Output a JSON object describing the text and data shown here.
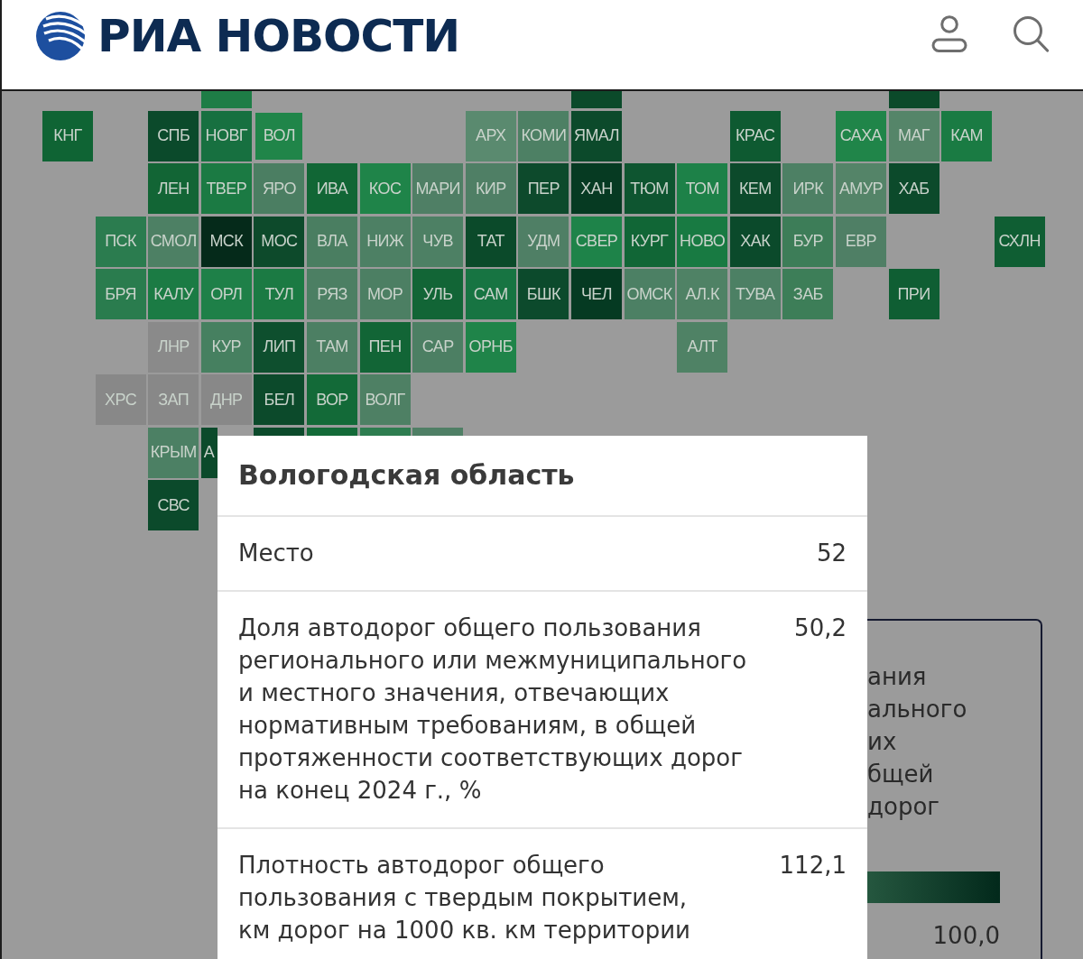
{
  "header": {
    "logo": "РИА НОВОСТИ"
  },
  "map": {
    "rows": [
      {
        "cells": [
          null,
          null,
          null,
          {
            "kind": "bottom",
            "color": "#1e7d46",
            "selected": false
          },
          null,
          null,
          null,
          null,
          null,
          null,
          {
            "kind": "bottom",
            "color": "#0b4a2a",
            "selected": false
          },
          null,
          null,
          null,
          null,
          null,
          {
            "kind": "bottom",
            "color": "#0b4a2a",
            "selected": false
          }
        ]
      },
      {
        "cells": [
          {
            "kind": "full",
            "label": "КНГ",
            "color": "#0f6434",
            "selected": false
          },
          null,
          {
            "kind": "full",
            "label": "СПБ",
            "color": "#0b4a2b",
            "selected": false
          },
          {
            "kind": "full",
            "label": "НОВГ",
            "color": "#177040",
            "selected": false
          },
          {
            "kind": "full",
            "label": "ВОЛ",
            "color": "#208549",
            "selected": true
          },
          null,
          null,
          null,
          {
            "kind": "full",
            "label": "АРХ",
            "color": "#5a8a6f",
            "selected": false
          },
          {
            "kind": "full",
            "label": "КОМИ",
            "color": "#4d8064",
            "selected": false
          },
          {
            "kind": "full",
            "label": "ЯМАЛ",
            "color": "#0c4a2b",
            "selected": false
          },
          null,
          null,
          {
            "kind": "full",
            "label": "КРАС",
            "color": "#0e5a31",
            "selected": false
          },
          null,
          {
            "kind": "full",
            "label": "САХА",
            "color": "#208549",
            "selected": false
          },
          {
            "kind": "full",
            "label": "МАГ",
            "color": "#558569",
            "selected": false
          },
          {
            "kind": "full",
            "label": "КАМ",
            "color": "#1a7b43",
            "selected": false
          }
        ]
      },
      {
        "cells": [
          null,
          null,
          {
            "kind": "full",
            "label": "ЛЕН",
            "color": "#126535",
            "selected": false
          },
          {
            "kind": "full",
            "label": "ТВЕР",
            "color": "#1b7a43",
            "selected": false
          },
          {
            "kind": "full",
            "label": "ЯРО",
            "color": "#4b7e62",
            "selected": false
          },
          {
            "kind": "full",
            "label": "ИВА",
            "color": "#116635",
            "selected": false
          },
          {
            "kind": "full",
            "label": "КОС",
            "color": "#1f8449",
            "selected": false
          },
          {
            "kind": "full",
            "label": "МАРИ",
            "color": "#4f7f65",
            "selected": false
          },
          {
            "kind": "full",
            "label": "КИР",
            "color": "#4f7f65",
            "selected": false
          },
          {
            "kind": "full",
            "label": "ПЕР",
            "color": "#0d4a2c",
            "selected": false
          },
          {
            "kind": "full",
            "label": "ХАН",
            "color": "#063a22",
            "selected": false
          },
          {
            "kind": "full",
            "label": "ТЮМ",
            "color": "#0e5530",
            "selected": false
          },
          {
            "kind": "full",
            "label": "ТОМ",
            "color": "#1d8148",
            "selected": false
          },
          {
            "kind": "full",
            "label": "КЕМ",
            "color": "#0c4a2b",
            "selected": false
          },
          {
            "kind": "full",
            "label": "ИРК",
            "color": "#4d8064",
            "selected": false
          },
          {
            "kind": "full",
            "label": "АМУР",
            "color": "#548468",
            "selected": false
          },
          {
            "kind": "full",
            "label": "ХАБ",
            "color": "#0c4a2b",
            "selected": false
          }
        ]
      },
      {
        "cells": [
          null,
          {
            "kind": "full",
            "label": "ПСК",
            "color": "#2b7c4f",
            "selected": false
          },
          {
            "kind": "full",
            "label": "СМОЛ",
            "color": "#4d8064",
            "selected": false
          },
          {
            "kind": "full",
            "label": "МСК",
            "color": "#052a1a",
            "selected": false
          },
          {
            "kind": "full",
            "label": "МОС",
            "color": "#0d4a2b",
            "selected": false
          },
          {
            "kind": "full",
            "label": "ВЛА",
            "color": "#4a7e61",
            "selected": false
          },
          {
            "kind": "full",
            "label": "НИЖ",
            "color": "#4d8064",
            "selected": false
          },
          {
            "kind": "full",
            "label": "ЧУВ",
            "color": "#4d8064",
            "selected": false
          },
          {
            "kind": "full",
            "label": "ТАТ",
            "color": "#0b4a2a",
            "selected": false
          },
          {
            "kind": "full",
            "label": "УДМ",
            "color": "#4f7f65",
            "selected": false
          },
          {
            "kind": "full",
            "label": "СВЕР",
            "color": "#1e8349",
            "selected": false
          },
          {
            "kind": "full",
            "label": "КУРГ",
            "color": "#116636",
            "selected": false
          },
          {
            "kind": "full",
            "label": "НОВО",
            "color": "#187a42",
            "selected": false
          },
          {
            "kind": "full",
            "label": "ХАК",
            "color": "#0b4a2b",
            "selected": false
          },
          {
            "kind": "full",
            "label": "БУР",
            "color": "#3d7d58",
            "selected": false
          },
          {
            "kind": "full",
            "label": "ЕВР",
            "color": "#4f7f65",
            "selected": false
          },
          null,
          null,
          {
            "kind": "full",
            "label": "СХЛН",
            "color": "#0f5e33",
            "selected": false
          }
        ]
      },
      {
        "cells": [
          null,
          {
            "kind": "full",
            "label": "БРЯ",
            "color": "#2a7c4e",
            "selected": false
          },
          {
            "kind": "full",
            "label": "КАЛУ",
            "color": "#1b7b44",
            "selected": false
          },
          {
            "kind": "full",
            "label": "ОРЛ",
            "color": "#1e8048",
            "selected": false
          },
          {
            "kind": "full",
            "label": "ТУЛ",
            "color": "#1b7a43",
            "selected": false
          },
          {
            "kind": "full",
            "label": "РЯЗ",
            "color": "#4c7f63",
            "selected": false
          },
          {
            "kind": "full",
            "label": "МОР",
            "color": "#4c7f63",
            "selected": false
          },
          {
            "kind": "full",
            "label": "УЛЬ",
            "color": "#126536",
            "selected": false
          },
          {
            "kind": "full",
            "label": "САМ",
            "color": "#177442",
            "selected": false
          },
          {
            "kind": "full",
            "label": "БШК",
            "color": "#0c4a2c",
            "selected": false
          },
          {
            "kind": "full",
            "label": "ЧЕЛ",
            "color": "#053a22",
            "selected": false
          },
          {
            "kind": "full",
            "label": "ОМСК",
            "color": "#4c8064",
            "selected": false
          },
          {
            "kind": "full",
            "label": "АЛ.К",
            "color": "#4f8265",
            "selected": false
          },
          {
            "kind": "full",
            "label": "ТУВА",
            "color": "#4c8064",
            "selected": false
          },
          {
            "kind": "full",
            "label": "ЗАБ",
            "color": "#3d7e58",
            "selected": false
          },
          null,
          {
            "kind": "full",
            "label": "ПРИ",
            "color": "#0f5e33",
            "selected": false
          }
        ]
      },
      {
        "cells": [
          null,
          null,
          {
            "kind": "full",
            "label": "ЛНР",
            "color": "#8a8a8a",
            "selected": false
          },
          {
            "kind": "full",
            "label": "КУР",
            "color": "#468060",
            "selected": false
          },
          {
            "kind": "full",
            "label": "ЛИП",
            "color": "#0e4f2e",
            "selected": false
          },
          {
            "kind": "full",
            "label": "ТАМ",
            "color": "#4c7f63",
            "selected": false
          },
          {
            "kind": "full",
            "label": "ПЕН",
            "color": "#126536",
            "selected": false
          },
          {
            "kind": "full",
            "label": "САР",
            "color": "#4c7f63",
            "selected": false
          },
          {
            "kind": "full",
            "label": "ОРНБ",
            "color": "#1f8449",
            "selected": false
          },
          null,
          null,
          null,
          {
            "kind": "full",
            "label": "АЛТ",
            "color": "#4f8265",
            "selected": false
          }
        ]
      },
      {
        "cells": [
          null,
          {
            "kind": "full",
            "label": "ХРС",
            "color": "#888888",
            "selected": false
          },
          {
            "kind": "full",
            "label": "ЗАП",
            "color": "#888888",
            "selected": false
          },
          {
            "kind": "full",
            "label": "ДНР",
            "color": "#888888",
            "selected": false
          },
          {
            "kind": "full",
            "label": "БЕЛ",
            "color": "#0c4a2b",
            "selected": false
          },
          {
            "kind": "full",
            "label": "ВОР",
            "color": "#136a38",
            "selected": false
          },
          {
            "kind": "full",
            "label": "ВОЛГ",
            "color": "#4e8064",
            "selected": false
          }
        ]
      },
      {
        "cells": [
          null,
          null,
          {
            "kind": "full",
            "label": "КРЫМ",
            "color": "#4c8064",
            "selected": false
          },
          {
            "kind": "left",
            "label": "А",
            "color": "#0b4a2b",
            "selected": false
          },
          {
            "kind": "top",
            "color": "#0c4a2b",
            "selected": false
          },
          {
            "kind": "top",
            "color": "#136a38",
            "selected": false
          },
          {
            "kind": "top",
            "color": "#2e7d50",
            "selected": false
          },
          {
            "kind": "top",
            "color": "#4f7f65",
            "selected": false
          }
        ]
      },
      {
        "cells": [
          null,
          null,
          {
            "kind": "full",
            "label": "СВС",
            "color": "#0b4a2b",
            "selected": false
          }
        ]
      }
    ]
  },
  "legend": {
    "lines": [
      "ания",
      "ального",
      "их",
      "бщей",
      "дорог"
    ],
    "max_label": "100,0"
  },
  "popup": {
    "title": "Вологодская область",
    "rows": [
      {
        "label": "Место",
        "value": "52"
      },
      {
        "label": "Доля автодорог общего пользования\nрегионального или межмуниципального\nи местного значения, отвечающих\nнормативным требованиям, в общей\nпротяженности соответствующих дорог\nна конец 2024 г., %",
        "value": "50,2"
      },
      {
        "label": "Плотность автодорог общего\nпользования с твердым покрытием,\nкм дорог на 1000 кв. км территории",
        "value": "112,1"
      }
    ]
  }
}
